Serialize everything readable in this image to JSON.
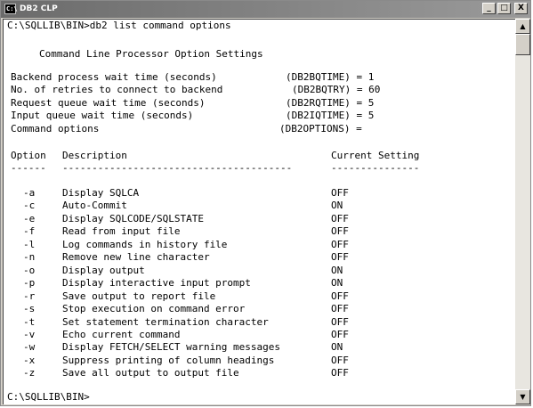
{
  "window": {
    "title": "DB2 CLP",
    "icon_label": "C:\\",
    "buttons": {
      "minimize": "_",
      "maximize": "□",
      "close": "X"
    }
  },
  "console": {
    "command_line": "C:\\SQLLIB\\BIN>db2 list command options",
    "heading": "Command Line Processor Option Settings",
    "settings": [
      {
        "label": "Backend process wait time (seconds)",
        "var": "(DB2BQTIME) = 1"
      },
      {
        "label": "No. of retries to connect to backend",
        "var": "(DB2BQTRY) = 60"
      },
      {
        "label": "Request queue wait time (seconds)",
        "var": "(DB2RQTIME) = 5"
      },
      {
        "label": "Input queue wait time (seconds)",
        "var": "(DB2IQTIME) = 5"
      },
      {
        "label": "Command options",
        "var": "(DB2OPTIONS) ="
      }
    ],
    "columns": {
      "option": "Option",
      "description": "Description",
      "current": "Current Setting"
    },
    "dividers": {
      "option": "------",
      "description": "---------------------------------------",
      "current": "---------------"
    },
    "options": [
      {
        "flag": "-a",
        "desc": "Display SQLCA",
        "value": "OFF"
      },
      {
        "flag": "-c",
        "desc": "Auto-Commit",
        "value": "ON"
      },
      {
        "flag": "-e",
        "desc": "Display SQLCODE/SQLSTATE",
        "value": "OFF"
      },
      {
        "flag": "-f",
        "desc": "Read from input file",
        "value": "OFF"
      },
      {
        "flag": "-l",
        "desc": "Log commands in history file",
        "value": "OFF"
      },
      {
        "flag": "-n",
        "desc": "Remove new line character",
        "value": "OFF"
      },
      {
        "flag": "-o",
        "desc": "Display output",
        "value": "ON"
      },
      {
        "flag": "-p",
        "desc": "Display interactive input prompt",
        "value": "ON"
      },
      {
        "flag": "-r",
        "desc": "Save output to report file",
        "value": "OFF"
      },
      {
        "flag": "-s",
        "desc": "Stop execution on command error",
        "value": "OFF"
      },
      {
        "flag": "-t",
        "desc": "Set statement termination character",
        "value": "OFF"
      },
      {
        "flag": "-v",
        "desc": "Echo current command",
        "value": "OFF"
      },
      {
        "flag": "-w",
        "desc": "Display FETCH/SELECT warning messages",
        "value": "ON"
      },
      {
        "flag": "-x",
        "desc": "Suppress printing of column headings",
        "value": "OFF"
      },
      {
        "flag": "-z",
        "desc": "Save all output to output file",
        "value": "OFF"
      }
    ],
    "prompt": "C:\\SQLLIB\\BIN>"
  },
  "scrollbar": {
    "up_arrow": "▲",
    "down_arrow": "▼"
  }
}
